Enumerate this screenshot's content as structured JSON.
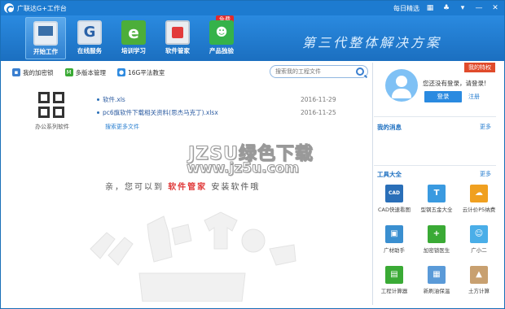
{
  "titlebar": {
    "title": "广联达G+工作台",
    "daily_link": "每日精选"
  },
  "toolbar": {
    "tabs": [
      {
        "label": "开始工作"
      },
      {
        "label": "在线服务"
      },
      {
        "label": "培训学习"
      },
      {
        "label": "软件管家"
      },
      {
        "label": "产品独验",
        "badge": "免费"
      }
    ],
    "slogan": "第三代整体解决方案"
  },
  "my_privileges": "我的特权",
  "actions": [
    {
      "label": "我的加密锁",
      "icon": "lock-icon"
    },
    {
      "label": "多版本管理",
      "icon": "m-icon"
    },
    {
      "label": "16G平法教室",
      "icon": "cloud-icon"
    }
  ],
  "search": {
    "placeholder": "搜索我的工程文件"
  },
  "office": {
    "label": "办公系列软件"
  },
  "files": [
    {
      "name": "软件.xls",
      "date": "2016-11-29"
    },
    {
      "name": "pc6旗软件下载相关资料(思杰马克丁).xlsx",
      "date": "2016-11-25"
    }
  ],
  "more_files": "搜索更多文件",
  "watermark": {
    "line1": "JZSU绿色下载",
    "line2": "www.jz5u.com"
  },
  "tip": {
    "prefix": "亲，您可以到",
    "highlight": "软件管家",
    "suffix": "安装软件哦"
  },
  "user": {
    "hint": "您还没有登录，请登录!",
    "login": "登录",
    "register": "注册"
  },
  "messages": {
    "title": "我的消息",
    "more": "更多"
  },
  "tools": {
    "title": "工具大全",
    "more": "更多",
    "items": [
      {
        "label": "CAD快速看图",
        "color": "#2a6fb8",
        "glyph": "CAD"
      },
      {
        "label": "型钢五金大全",
        "color": "#3a9ae0",
        "glyph": "T"
      },
      {
        "label": "云计价P5纳费",
        "color": "#f0a020",
        "glyph": "☁"
      },
      {
        "label": "广材助手",
        "color": "#3a8fd0",
        "glyph": "▣"
      },
      {
        "label": "加密锁医生",
        "color": "#3aaa35",
        "glyph": "+"
      },
      {
        "label": "广小二",
        "color": "#4aaee8",
        "glyph": "☺"
      },
      {
        "label": "工程计算器",
        "color": "#3aaa35",
        "glyph": "▤"
      },
      {
        "label": "新刷油保温",
        "color": "#5a9ad8",
        "glyph": "▦"
      },
      {
        "label": "土方计算",
        "color": "#c8a070",
        "glyph": "▲"
      }
    ]
  }
}
